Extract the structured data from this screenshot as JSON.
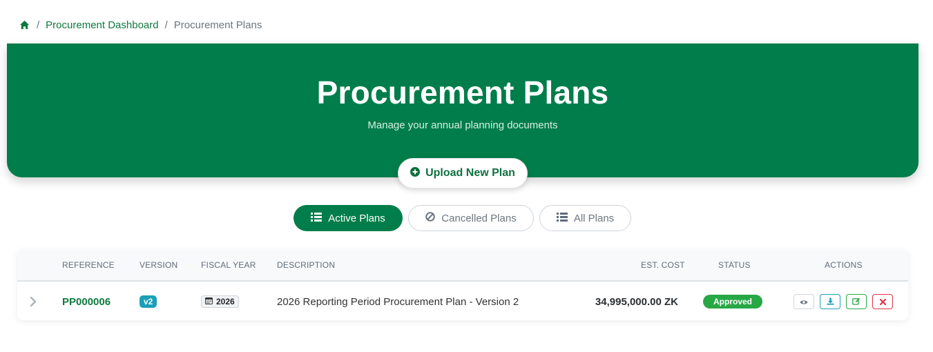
{
  "breadcrumb": {
    "home_icon": "home-icon",
    "separator": "/",
    "dashboard": "Procurement Dashboard",
    "current": "Procurement Plans"
  },
  "hero": {
    "title": "Procurement Plans",
    "subtitle": "Manage your annual planning documents",
    "color": "#007d4a"
  },
  "upload_button": {
    "label": "Upload New Plan",
    "icon": "plus-circle-icon"
  },
  "tabs": [
    {
      "label": "Active Plans",
      "icon": "list-icon",
      "active": true
    },
    {
      "label": "Cancelled Plans",
      "icon": "ban-icon",
      "active": false
    },
    {
      "label": "All Plans",
      "icon": "list-icon",
      "active": false
    }
  ],
  "table": {
    "headers": {
      "reference": "REFERENCE",
      "version": "VERSION",
      "fiscal_year": "FISCAL YEAR",
      "description": "DESCRIPTION",
      "est_cost": "EST. COST",
      "status": "STATUS",
      "actions": "ACTIONS"
    },
    "rows": [
      {
        "reference": "PP000006",
        "version": "v2",
        "fiscal_year": "2026",
        "description": "2026 Reporting Period Procurement Plan - Version 2",
        "est_cost": "34,995,000.00 ZK",
        "status": "Approved",
        "actions": [
          "eye-icon",
          "download-icon",
          "edit-icon",
          "close-icon"
        ]
      }
    ]
  }
}
